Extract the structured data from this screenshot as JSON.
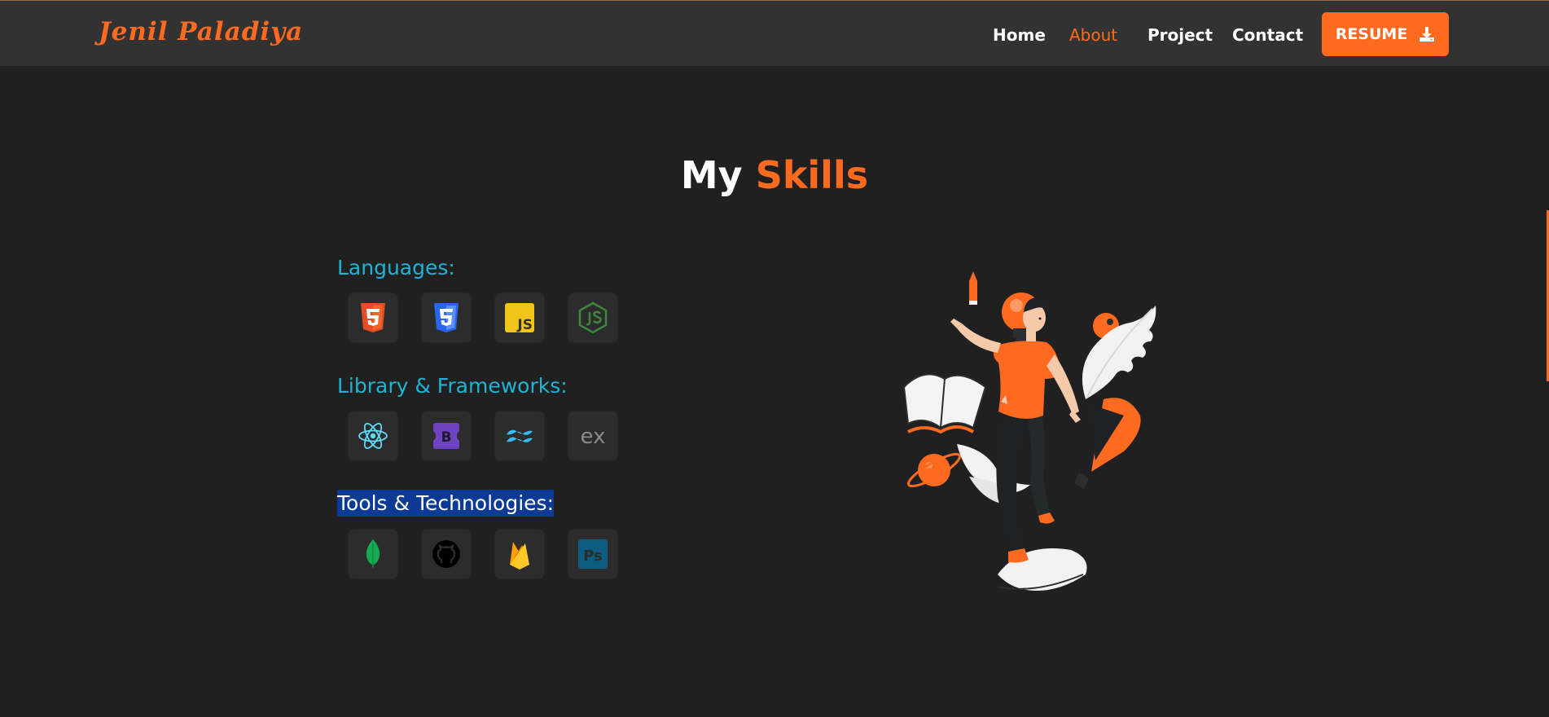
{
  "navbar": {
    "logo": "Jenil Paladiya",
    "links": [
      {
        "label": "Home",
        "active": false
      },
      {
        "label": "About",
        "active": true
      },
      {
        "label": "Project",
        "active": false
      },
      {
        "label": "Contact",
        "active": false
      }
    ],
    "resume_label": "RESUME"
  },
  "skills": {
    "title_prefix": "My",
    "title_accent": "Skills",
    "sections": [
      {
        "heading": "Languages:",
        "icons": [
          "html5-icon",
          "css3-icon",
          "javascript-icon",
          "nodejs-icon"
        ]
      },
      {
        "heading": "Library & Frameworks:",
        "icons": [
          "react-icon",
          "bootstrap-icon",
          "tailwind-icon",
          "express-icon"
        ]
      },
      {
        "heading": "Tools & Technologies:",
        "icons": [
          "mongodb-icon",
          "github-icon",
          "firebase-icon",
          "photoshop-icon"
        ]
      }
    ],
    "icon_text": {
      "javascript": "JS",
      "bootstrap": "B",
      "express": "ex",
      "photoshop": "Ps"
    }
  },
  "colors": {
    "accent": "#ff6a21",
    "heading": "#1fb4d6",
    "background": "#202020",
    "navbar": "#323232"
  }
}
